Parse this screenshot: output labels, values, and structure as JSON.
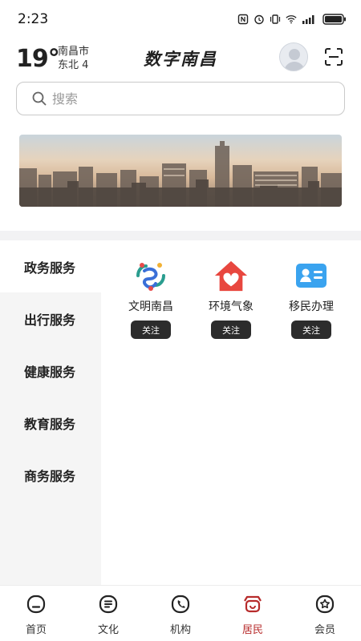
{
  "status_bar": {
    "time": "2:23"
  },
  "header": {
    "temperature": "19°",
    "city": "南昌市",
    "wind": "东北 4",
    "title": "数字南昌"
  },
  "search": {
    "placeholder": "搜索"
  },
  "categories": [
    {
      "label": "政务服务",
      "active": true
    },
    {
      "label": "出行服务",
      "active": false
    },
    {
      "label": "健康服务",
      "active": false
    },
    {
      "label": "教育服务",
      "active": false
    },
    {
      "label": "商务服务",
      "active": false
    }
  ],
  "services": [
    {
      "label": "文明南昌",
      "follow": "关注",
      "icon": "civilization-logo-icon"
    },
    {
      "label": "环境气象",
      "follow": "关注",
      "icon": "house-heart-icon"
    },
    {
      "label": "移民办理",
      "follow": "关注",
      "icon": "id-card-icon"
    }
  ],
  "bottom_nav": [
    {
      "label": "首页",
      "icon": "home-icon",
      "active": false
    },
    {
      "label": "文化",
      "icon": "culture-icon",
      "active": false
    },
    {
      "label": "机构",
      "icon": "phone-icon",
      "active": false
    },
    {
      "label": "居民",
      "icon": "resident-icon",
      "active": true
    },
    {
      "label": "会员",
      "icon": "member-star-icon",
      "active": false
    }
  ],
  "colors": {
    "accent": "#b72b2b",
    "follow_button": "#2c2c2c",
    "sidebar_bg": "#f5f5f5"
  }
}
